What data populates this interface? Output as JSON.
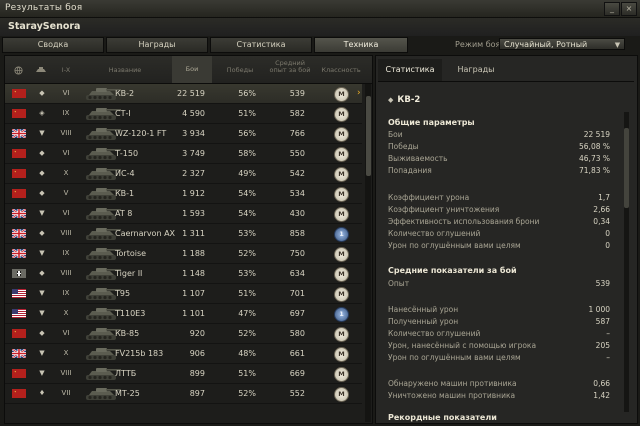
{
  "window": {
    "title": "Результаты боя",
    "btn_minimize": "_",
    "btn_close": "×"
  },
  "player": {
    "name": "StaraySenora"
  },
  "tabs": [
    {
      "label": "Сводка"
    },
    {
      "label": "Награды"
    },
    {
      "label": "Статистика"
    },
    {
      "label": "Техника"
    }
  ],
  "battle_mode": {
    "label": "Режим боя:",
    "value": "Случайный, Ротный"
  },
  "table_headers": {
    "tier": "I-X",
    "name": "Название",
    "battles": "Бои",
    "wins": "Победы",
    "avg_xp": "Средний опыт за бой",
    "mastery": "Классность"
  },
  "vehicles": [
    {
      "flag": "ussr",
      "class": "heavy",
      "tier": "VI",
      "name": "КВ-2",
      "battles": "22 519",
      "wins": "56%",
      "avg_xp": "539",
      "mastery": "M",
      "selected": true
    },
    {
      "flag": "ussr",
      "class": "medium",
      "tier": "IX",
      "name": "СТ-I",
      "battles": "4 590",
      "wins": "51%",
      "avg_xp": "582",
      "mastery": "M"
    },
    {
      "flag": "uk",
      "class": "td",
      "tier": "VIII",
      "name": "WZ-120-1 FT",
      "battles": "3 934",
      "wins": "56%",
      "avg_xp": "766",
      "mastery": "M"
    },
    {
      "flag": "ussr",
      "class": "heavy",
      "tier": "VI",
      "name": "Т-150",
      "battles": "3 749",
      "wins": "58%",
      "avg_xp": "550",
      "mastery": "M"
    },
    {
      "flag": "ussr",
      "class": "heavy",
      "tier": "X",
      "name": "ИС-4",
      "battles": "2 327",
      "wins": "49%",
      "avg_xp": "542",
      "mastery": "M"
    },
    {
      "flag": "ussr",
      "class": "heavy",
      "tier": "V",
      "name": "КВ-1",
      "battles": "1 912",
      "wins": "54%",
      "avg_xp": "534",
      "mastery": "M"
    },
    {
      "flag": "uk",
      "class": "td",
      "tier": "VI",
      "name": "AT 8",
      "battles": "1 593",
      "wins": "54%",
      "avg_xp": "430",
      "mastery": "M"
    },
    {
      "flag": "uk",
      "class": "heavy",
      "tier": "VIII",
      "name": "Caernarvon AX",
      "battles": "1 311",
      "wins": "53%",
      "avg_xp": "858",
      "mastery": "1"
    },
    {
      "flag": "uk",
      "class": "td",
      "tier": "IX",
      "name": "Tortoise",
      "battles": "1 188",
      "wins": "52%",
      "avg_xp": "750",
      "mastery": "M"
    },
    {
      "flag": "ger",
      "class": "heavy",
      "tier": "VIII",
      "name": "Tiger II",
      "battles": "1 148",
      "wins": "53%",
      "avg_xp": "634",
      "mastery": "M"
    },
    {
      "flag": "us",
      "class": "td",
      "tier": "IX",
      "name": "T95",
      "battles": "1 107",
      "wins": "51%",
      "avg_xp": "701",
      "mastery": "M"
    },
    {
      "flag": "us",
      "class": "td",
      "tier": "X",
      "name": "T110E3",
      "battles": "1 101",
      "wins": "47%",
      "avg_xp": "697",
      "mastery": "1"
    },
    {
      "flag": "ussr",
      "class": "heavy",
      "tier": "VI",
      "name": "КВ-85",
      "battles": "920",
      "wins": "52%",
      "avg_xp": "580",
      "mastery": "M"
    },
    {
      "flag": "uk",
      "class": "td",
      "tier": "X",
      "name": "FV215b 183",
      "battles": "906",
      "wins": "48%",
      "avg_xp": "661",
      "mastery": "M"
    },
    {
      "flag": "ussr",
      "class": "td",
      "tier": "VIII",
      "name": "ЛТТБ",
      "battles": "899",
      "wins": "51%",
      "avg_xp": "669",
      "mastery": "M"
    },
    {
      "flag": "ussr",
      "class": "light",
      "tier": "VII",
      "name": "МТ-25",
      "battles": "897",
      "wins": "52%",
      "avg_xp": "552",
      "mastery": "M"
    }
  ],
  "detail": {
    "tabs": [
      {
        "label": "Статистика"
      },
      {
        "label": "Награды"
      }
    ],
    "tank_name": "КВ-2",
    "general_title": "Общие параметры",
    "general": [
      {
        "label": "Бои",
        "value": "22 519"
      },
      {
        "label": "Победы",
        "value": "56,08 %"
      },
      {
        "label": "Выживаемость",
        "value": "46,73 %"
      },
      {
        "label": "Попадания",
        "value": "71,83 %"
      }
    ],
    "ratios": [
      {
        "label": "Коэффициент урона",
        "value": "1,7"
      },
      {
        "label": "Коэффициент уничтожения",
        "value": "2,66"
      },
      {
        "label": "Эффективность использования брони",
        "value": "0,34"
      },
      {
        "label": "Количество оглушений",
        "value": "0"
      },
      {
        "label": "Урон по оглушённым вами целям",
        "value": "0"
      }
    ],
    "avg_title": "Средние показатели за бой",
    "avg": [
      {
        "label": "Опыт",
        "value": "539"
      }
    ],
    "damage": [
      {
        "label": "Нанесённый урон",
        "value": "1 000"
      },
      {
        "label": "Полученный урон",
        "value": "587"
      },
      {
        "label": "Количество оглушений",
        "value": "–"
      },
      {
        "label": "Урон, нанесённый с помощью игрока",
        "value": "205"
      },
      {
        "label": "Урон по оглушённым вами целям",
        "value": "–"
      }
    ],
    "enemies": [
      {
        "label": "Обнаружено машин противника",
        "value": "0,66"
      },
      {
        "label": "Уничтожено машин противника",
        "value": "1,42"
      }
    ],
    "records_title": "Рекордные показатели"
  },
  "colors": {
    "gold_arrow": "#f0b024",
    "panel_bg": "#262624",
    "row_selected": "#38382f"
  }
}
